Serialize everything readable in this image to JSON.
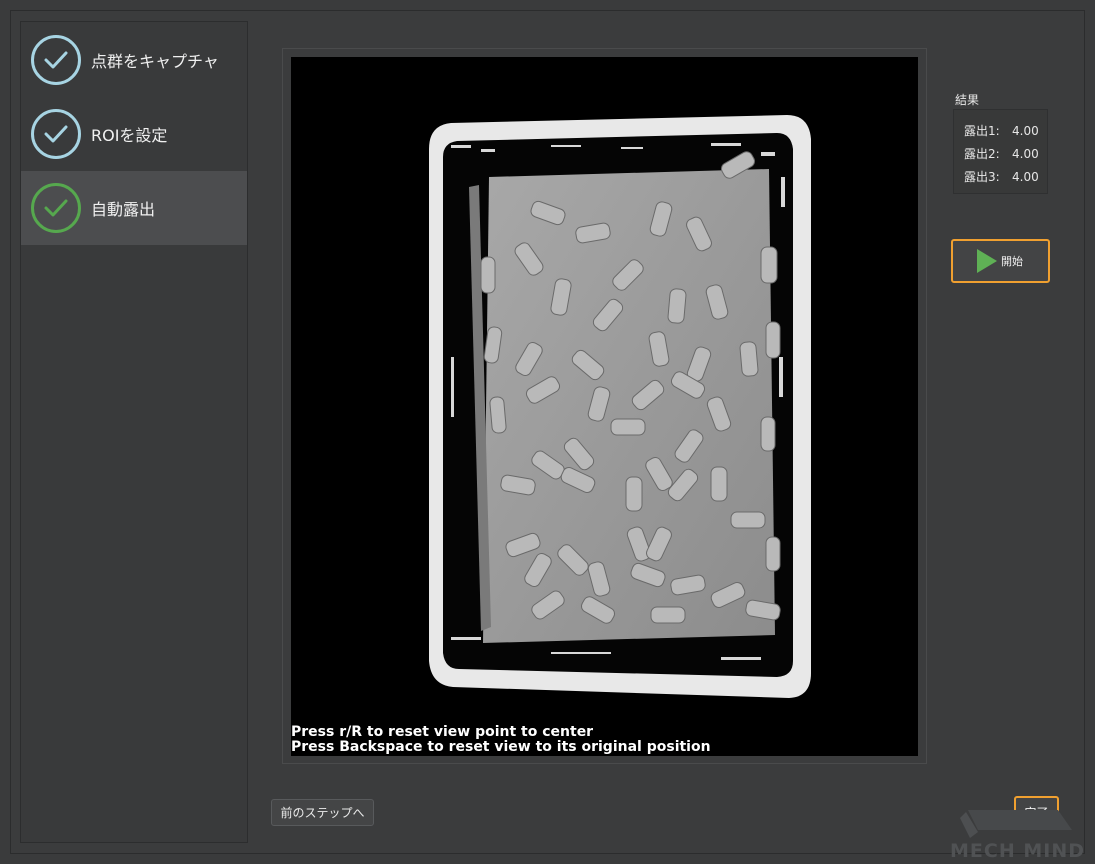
{
  "steps": [
    {
      "label": "点群をキャプチャ",
      "status": "done",
      "active": false
    },
    {
      "label": "ROIを設定",
      "status": "done",
      "active": false
    },
    {
      "label": "自動露出",
      "status": "done",
      "active": true
    }
  ],
  "viewer": {
    "hint_line1": "Press r/R to reset view point to center",
    "hint_line2": "Press Backspace to reset view to its original position"
  },
  "results": {
    "title": "結果",
    "rows": [
      {
        "key": "露出1:",
        "value": "4.00"
      },
      {
        "key": "露出2:",
        "value": "4.00"
      },
      {
        "key": "露出3:",
        "value": "4.00"
      }
    ]
  },
  "buttons": {
    "start_label": "開始",
    "prev_label": "前のステップへ",
    "done_label": "完了"
  },
  "logo": {
    "text": "MECH MIND"
  },
  "colors": {
    "accent_orange": "#f0a030",
    "check_blue": "#a7d4e3",
    "check_green": "#56a84e",
    "play_green": "#5fb155"
  },
  "icons": {
    "step_check": "check-icon",
    "start": "play-icon"
  }
}
